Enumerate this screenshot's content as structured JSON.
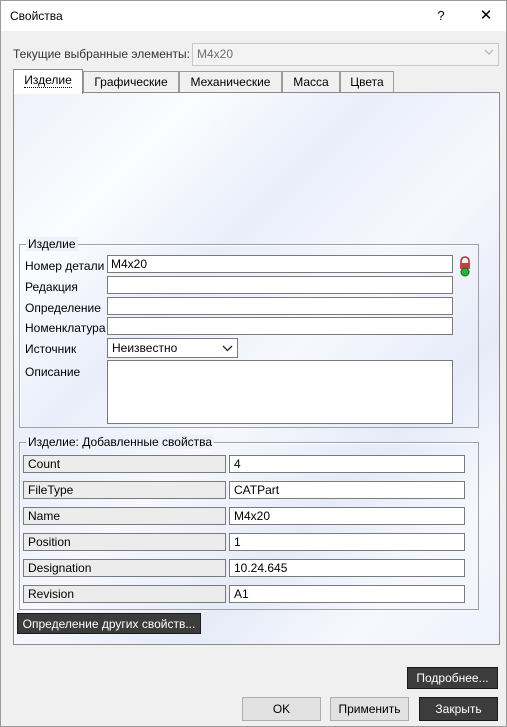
{
  "window": {
    "title": "Свойства",
    "help": "?",
    "close": "✕"
  },
  "selection": {
    "label": "Текущие выбранные элементы:",
    "value": "M4x20"
  },
  "tabs": [
    "Изделие",
    "Графические",
    "Механические",
    "Масса",
    "Цвета"
  ],
  "product": {
    "legend": "Изделие",
    "part_number": {
      "label": "Номер детали",
      "value": "M4x20"
    },
    "revision": {
      "label": "Редакция",
      "value": ""
    },
    "definition": {
      "label": "Определение",
      "value": ""
    },
    "nomenclature": {
      "label": "Номенклатура",
      "value": ""
    },
    "source": {
      "label": "Источник",
      "value": "Неизвестно"
    },
    "description": {
      "label": "Описание",
      "value": ""
    }
  },
  "added": {
    "legend": "Изделие: Добавленные свойства",
    "rows": [
      {
        "name": "Count",
        "value": "4"
      },
      {
        "name": "FileType",
        "value": "CATPart"
      },
      {
        "name": "Name",
        "value": "M4x20"
      },
      {
        "name": "Position",
        "value": "1"
      },
      {
        "name": "Designation",
        "value": "10.24.645"
      },
      {
        "name": "Revision",
        "value": "A1"
      }
    ],
    "define_button": "Определение других свойств..."
  },
  "buttons": {
    "more": "Подробнее...",
    "ok": "OK",
    "apply": "Применить",
    "close": "Закрыть"
  }
}
